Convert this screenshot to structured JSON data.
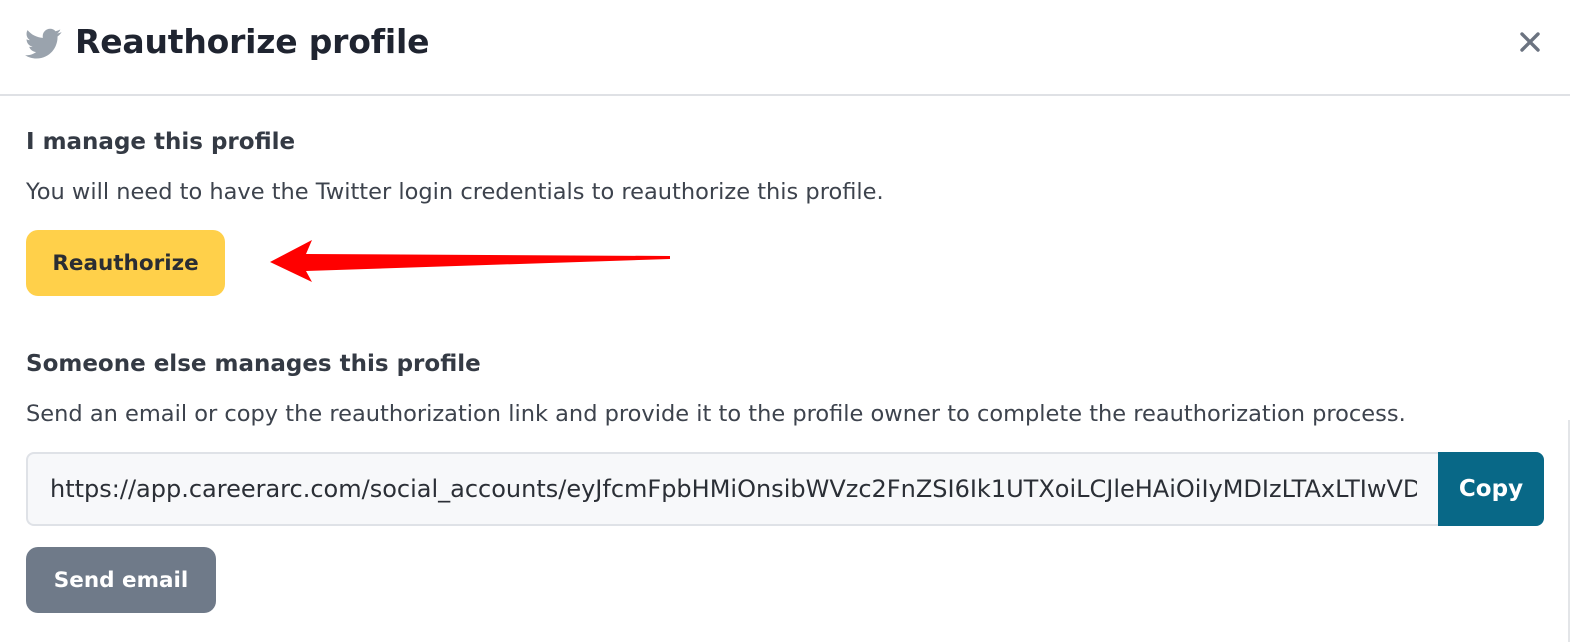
{
  "header": {
    "title": "Reauthorize profile",
    "icon": "twitter-bird-icon",
    "close_icon": "close-icon"
  },
  "self_managed": {
    "heading": "I manage this profile",
    "description": "You will need to have the Twitter login credentials to reauthorize this profile.",
    "button_label": "Reauthorize"
  },
  "other_managed": {
    "heading": "Someone else manages this profile",
    "description": "Send an email or copy the reauthorization link and provide it to the profile owner to complete the reauthorization process.",
    "link_value": "https://app.careerarc.com/social_accounts/eyJfcmFpbHMiOnsibWVzc2FnZSI6Ik1UTXoiLCJleHAiOiIyMDIzLTAxLTIwVDE2OjQ1OjAwLjAwMFoiLCJwdXIiOiJyZWF1dGhvcml6YXRpb24ifX0",
    "copy_label": "Copy",
    "email_label": "Send email"
  },
  "annotation": {
    "arrow_color": "#ff0000"
  },
  "colors": {
    "reauthorize_button": "#ffd04a",
    "copy_button": "#086887",
    "send_email_button": "#6f7a89",
    "twitter_icon": "#9aa3ad"
  }
}
